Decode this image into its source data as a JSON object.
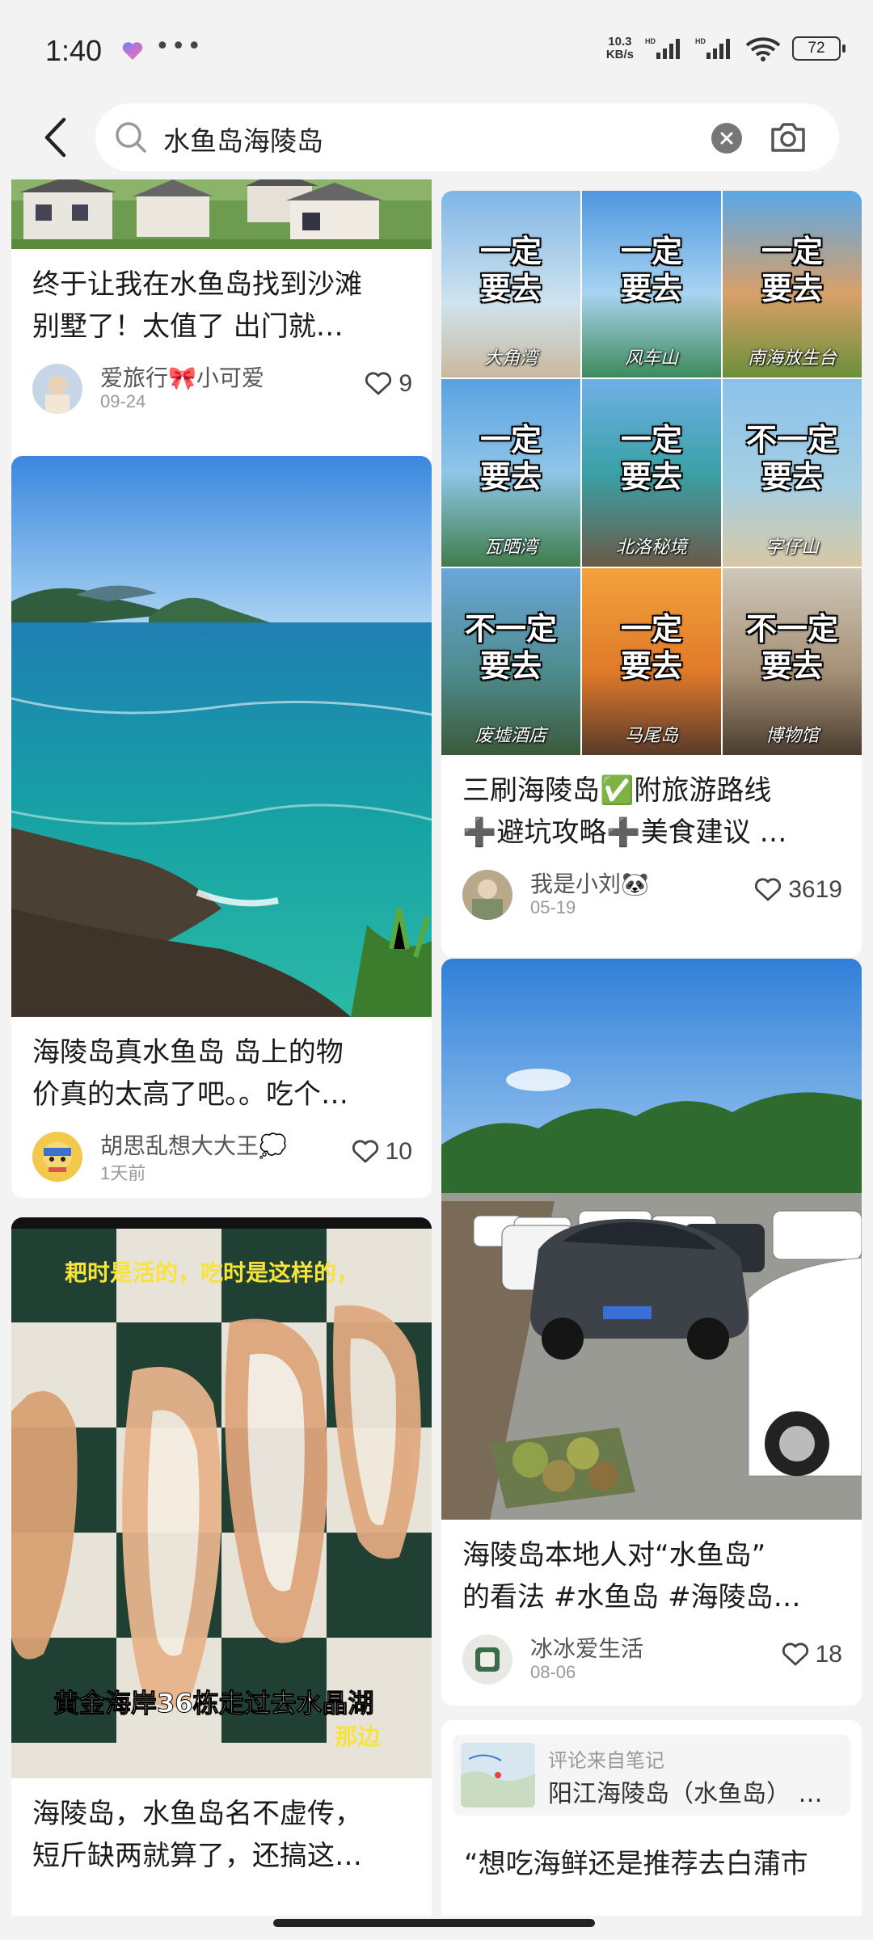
{
  "status_bar": {
    "time": "1:40",
    "more": "•••",
    "net_speed_value": "10.3",
    "net_speed_unit": "KB/s",
    "battery": "72"
  },
  "search": {
    "query": "水鱼岛海陵岛"
  },
  "left_cards": [
    {
      "title_lines": [
        "终于让我在水鱼岛找到沙滩",
        "别墅了！太值了 出门就…"
      ],
      "author": "爱旅行🎀小可爱",
      "date": "09-24",
      "likes": "9"
    },
    {
      "title_lines": [
        "海陵岛真水鱼岛 岛上的物",
        "价真的太高了吧。。吃个…"
      ],
      "author": "胡思乱想大大王💭",
      "date": "1天前",
      "likes": "10"
    },
    {
      "image_caption_top": "耙时是活的，吃时是这样的，",
      "image_caption_bottom": "黄金海岸36栋走过去水晶湖",
      "image_caption_bottom2": "那边",
      "title_lines": [
        "海陵岛，水鱼岛名不虚传，",
        "短斤缺两就算了，还搞这…"
      ]
    }
  ],
  "right_cards": [
    {
      "grid": [
        {
          "top": "一定\n要去",
          "label": "大角湾"
        },
        {
          "top": "一定\n要去",
          "label": "风车山"
        },
        {
          "top": "一定\n要去",
          "label": "南海放生台"
        },
        {
          "top": "一定\n要去",
          "label": "瓦晒湾"
        },
        {
          "top": "一定\n要去",
          "label": "北洛秘境"
        },
        {
          "top": "不一定\n要去",
          "label": "字仔山"
        },
        {
          "top": "不一定\n要去",
          "label": "废墟酒店"
        },
        {
          "top": "一定\n要去",
          "label": "马尾岛"
        },
        {
          "top": "不一定\n要去",
          "label": "博物馆"
        }
      ],
      "title_lines": [
        "三刷海陵岛✅附旅游路线",
        "➕避坑攻略➕美食建议 …"
      ],
      "author": "我是小刘🐼",
      "date": "05-19",
      "likes": "3619"
    },
    {
      "title_lines": [
        "海陵岛本地人对“水鱼岛”",
        "的看法 #水鱼岛 #海陵岛…"
      ],
      "author": "冰冰爱生活",
      "date": "08-06",
      "likes": "18"
    },
    {
      "quote_source": "评论来自笔记",
      "quote_title": "阳江海陵岛（水鱼岛） …",
      "quote_text": "“想吃海鲜还是推荐去白蒲市"
    }
  ],
  "colors": {
    "background": "#f3f3f3",
    "card": "#ffffff",
    "text": "#1a1a1a"
  }
}
